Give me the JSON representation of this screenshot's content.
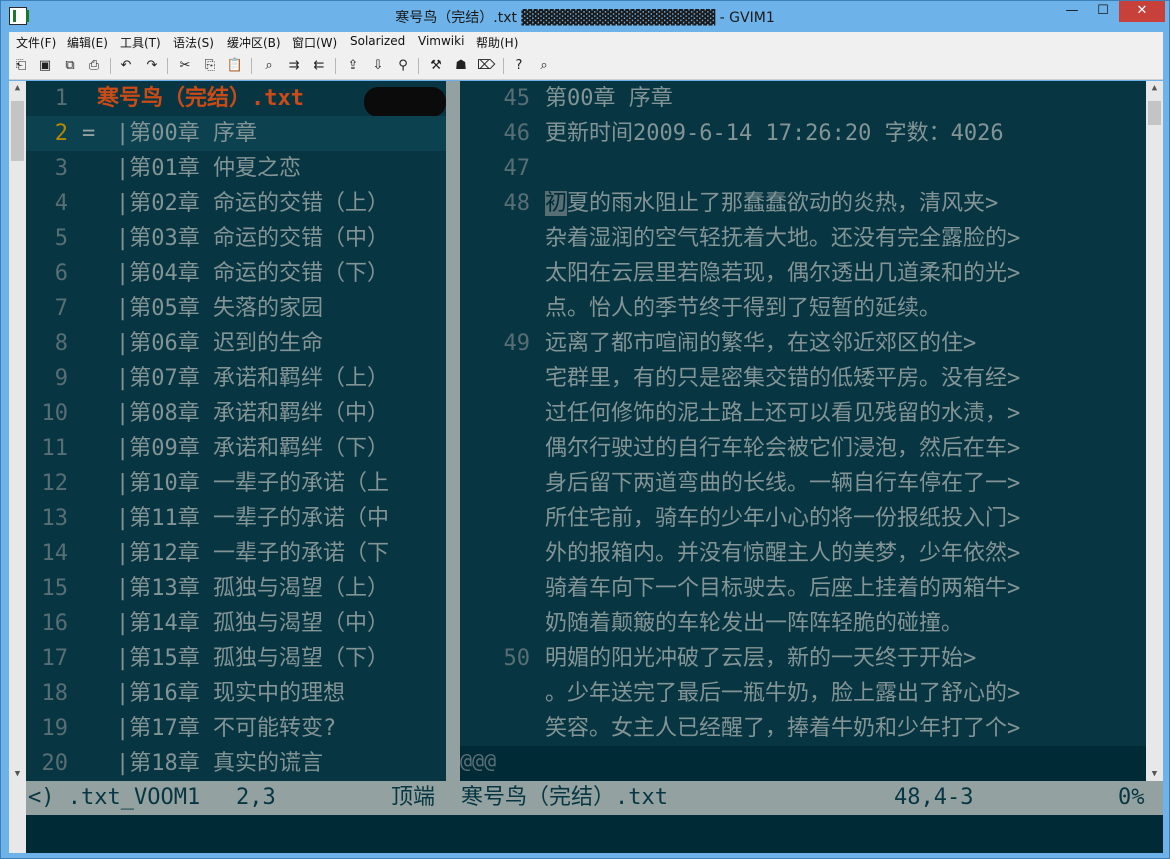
{
  "window": {
    "title": "寒号鸟（完结）.txt ▓▓▓▓▓▓▓▓▓▓▓▓▓▓▓▓▓▓ - GVIM1",
    "minimize": "—",
    "maximize": "☐",
    "close": "✕"
  },
  "menu": [
    "文件(F)",
    "编辑(E)",
    "工具(T)",
    "语法(S)",
    "缓冲区(B)",
    "窗口(W)",
    "Solarized",
    "Vimwiki",
    "帮助(H)"
  ],
  "toolbar_icons": [
    {
      "name": "open-icon",
      "glyph": "⎗"
    },
    {
      "name": "save-icon",
      "glyph": "▣"
    },
    {
      "name": "save-all-icon",
      "glyph": "⧉"
    },
    {
      "name": "print-icon",
      "glyph": "⎙"
    },
    {
      "name": "undo-icon",
      "glyph": "↶"
    },
    {
      "name": "redo-icon",
      "glyph": "↷"
    },
    {
      "name": "cut-icon",
      "glyph": "✂"
    },
    {
      "name": "copy-icon",
      "glyph": "⎘"
    },
    {
      "name": "paste-icon",
      "glyph": "📋"
    },
    {
      "name": "find-replace-icon",
      "glyph": "⌕"
    },
    {
      "name": "find-next-icon",
      "glyph": "⇉"
    },
    {
      "name": "find-prev-icon",
      "glyph": "⇇"
    },
    {
      "name": "load-session-icon",
      "glyph": "⇪"
    },
    {
      "name": "save-session-icon",
      "glyph": "⇩"
    },
    {
      "name": "run-script-icon",
      "glyph": "⚲"
    },
    {
      "name": "make-icon",
      "glyph": "⚒"
    },
    {
      "name": "shell-icon",
      "glyph": "☗"
    },
    {
      "name": "tag-jump-icon",
      "glyph": "⌦"
    },
    {
      "name": "help-icon",
      "glyph": "?"
    },
    {
      "name": "find-help-icon",
      "glyph": "⌕"
    }
  ],
  "left_pane": {
    "rows": [
      {
        "num": "1",
        "mark": "",
        "text": "寒号鸟（完结）.txt",
        "title": true
      },
      {
        "num": "2",
        "mark": "=",
        "text": "|第00章 序章",
        "current": true
      },
      {
        "num": "3",
        "mark": "",
        "text": "|第01章 仲夏之恋"
      },
      {
        "num": "4",
        "mark": "",
        "text": "|第02章 命运的交错（上）"
      },
      {
        "num": "5",
        "mark": "",
        "text": "|第03章 命运的交错（中）"
      },
      {
        "num": "6",
        "mark": "",
        "text": "|第04章 命运的交错（下）"
      },
      {
        "num": "7",
        "mark": "",
        "text": "|第05章 失落的家园"
      },
      {
        "num": "8",
        "mark": "",
        "text": "|第06章 迟到的生命"
      },
      {
        "num": "9",
        "mark": "",
        "text": "|第07章 承诺和羁绊（上）"
      },
      {
        "num": "10",
        "mark": "",
        "text": "|第08章 承诺和羁绊（中）"
      },
      {
        "num": "11",
        "mark": "",
        "text": "|第09章 承诺和羁绊（下）"
      },
      {
        "num": "12",
        "mark": "",
        "text": "|第10章 一辈子的承诺（上"
      },
      {
        "num": "13",
        "mark": "",
        "text": "|第11章 一辈子的承诺（中"
      },
      {
        "num": "14",
        "mark": "",
        "text": "|第12章 一辈子的承诺（下"
      },
      {
        "num": "15",
        "mark": "",
        "text": "|第13章 孤独与渴望（上）"
      },
      {
        "num": "16",
        "mark": "",
        "text": "|第14章 孤独与渴望（中）"
      },
      {
        "num": "17",
        "mark": "",
        "text": "|第15章 孤独与渴望（下）"
      },
      {
        "num": "18",
        "mark": "",
        "text": "|第16章 现实中的理想"
      },
      {
        "num": "19",
        "mark": "",
        "text": "|第17章 不可能转变?"
      },
      {
        "num": "20",
        "mark": "",
        "text": "|第18章 真实的谎言"
      }
    ]
  },
  "right_pane": {
    "lines": [
      {
        "num": "45",
        "text": "第00章 序章"
      },
      {
        "num": "46",
        "text": "更新时间2009-6-14 17:26:20  字数：4026"
      },
      {
        "num": "47",
        "text": ""
      },
      {
        "num": "48",
        "cursor_char": "初",
        "text": "  初夏的雨水阻止了那蠢蠢欲动的炎热，清风夹>"
      },
      {
        "num": "",
        "text": "杂着湿润的空气轻抚着大地。还没有完全露脸的>"
      },
      {
        "num": "",
        "text": "太阳在云层里若隐若现，偶尔透出几道柔和的光>"
      },
      {
        "num": "",
        "text": "点。怡人的季节终于得到了短暂的延续。"
      },
      {
        "num": "49",
        "text": "    远离了都市喧闹的繁华，在这邻近郊区的住>"
      },
      {
        "num": "",
        "text": "宅群里，有的只是密集交错的低矮平房。没有经>"
      },
      {
        "num": "",
        "text": "过任何修饰的泥土路上还可以看见残留的水渍，>"
      },
      {
        "num": "",
        "text": "偶尔行驶过的自行车轮会被它们浸泡，然后在车>"
      },
      {
        "num": "",
        "text": "身后留下两道弯曲的长线。一辆自行车停在了一>"
      },
      {
        "num": "",
        "text": "所住宅前，骑车的少年小心的将一份报纸投入门>"
      },
      {
        "num": "",
        "text": "外的报箱内。并没有惊醒主人的美梦，少年依然>"
      },
      {
        "num": "",
        "text": "骑着车向下一个目标驶去。后座上挂着的两箱牛>"
      },
      {
        "num": "",
        "text": "奶随着颠簸的车轮发出一阵阵轻脆的碰撞。"
      },
      {
        "num": "50",
        "text": "    明媚的阳光冲破了云层，新的一天终于开始>"
      },
      {
        "num": "",
        "text": "。少年送完了最后一瓶牛奶，脸上露出了舒心的>"
      },
      {
        "num": "",
        "text": "笑容。女主人已经醒了，捧着牛奶和少年打了个>"
      }
    ],
    "overflow_marker": "@@@"
  },
  "status": {
    "left_name": "<) .txt_VOOM1",
    "left_pos": "2,3",
    "left_scroll": "顶端",
    "right_name": "寒号鸟（完结）.txt",
    "right_pos": "48,4-3",
    "right_scroll": "0%"
  },
  "colors": {
    "base03": "#002b36",
    "base02": "#073642",
    "base01": "#586e75",
    "base0": "#839496",
    "base1": "#93a1a1",
    "yellow": "#b58900",
    "orange": "#cb4b16"
  }
}
